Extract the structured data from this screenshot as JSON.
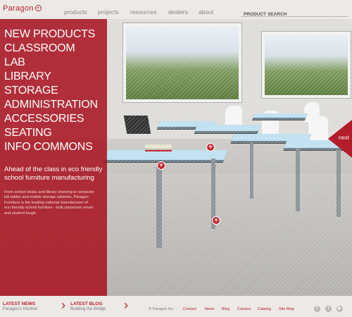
{
  "brand": {
    "name": "Paragon"
  },
  "nav": {
    "items": [
      "products",
      "projects",
      "resources",
      "dealers",
      "about"
    ]
  },
  "search": {
    "placeholder": "PRODUCT SEARCH"
  },
  "categories": [
    "NEW PRODUCTS",
    "CLASSROOM",
    "LAB",
    "LIBRARY",
    "STORAGE",
    "ADMINISTRATION",
    "ACCESSORIES",
    "SEATING",
    "INFO COMMONS"
  ],
  "hero": {
    "tagline": "Ahead of the class in eco friendly school furniture manufacturing",
    "blurb": "From school desks and library shelving to computer lab tables and mobile storage cabinets, Paragon Furniture is the leading national manufacturer of eco friendly school furniture - built classroom smart and student tough.",
    "next_label": "next"
  },
  "footer": {
    "news_title": "LATEST NEWS",
    "news_item": "Paragon's Intuitive",
    "blog_title": "LATEST BLOG",
    "blog_item": "Building the Bridge",
    "copyright": "© Paragon Inc.",
    "links": [
      "Contact",
      "News",
      "Blog",
      "Careers",
      "Catalog",
      "Site Map"
    ],
    "social_icons": [
      "facebook-icon",
      "twitter-icon",
      "youtube-icon"
    ]
  },
  "colors": {
    "brand_red": "#b6222c",
    "panel_red": "#a8121e"
  }
}
